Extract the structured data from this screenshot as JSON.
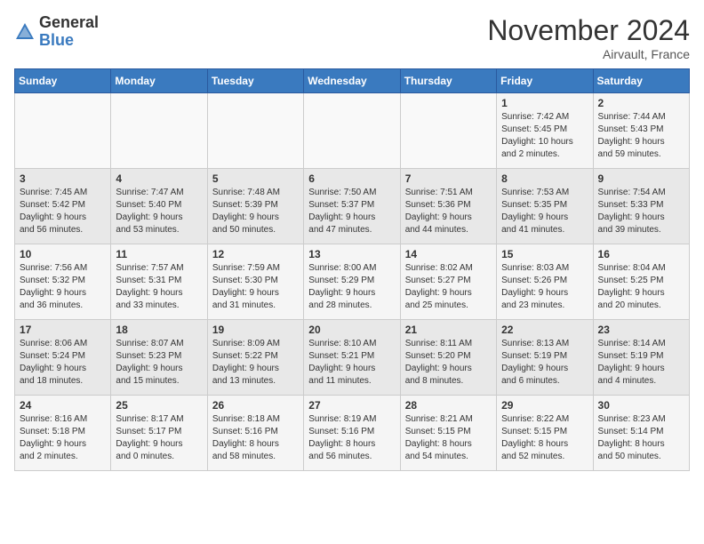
{
  "logo": {
    "general": "General",
    "blue": "Blue"
  },
  "header": {
    "month": "November 2024",
    "location": "Airvault, France"
  },
  "weekdays": [
    "Sunday",
    "Monday",
    "Tuesday",
    "Wednesday",
    "Thursday",
    "Friday",
    "Saturday"
  ],
  "weeks": [
    [
      {
        "day": "",
        "info": ""
      },
      {
        "day": "",
        "info": ""
      },
      {
        "day": "",
        "info": ""
      },
      {
        "day": "",
        "info": ""
      },
      {
        "day": "",
        "info": ""
      },
      {
        "day": "1",
        "info": "Sunrise: 7:42 AM\nSunset: 5:45 PM\nDaylight: 10 hours\nand 2 minutes."
      },
      {
        "day": "2",
        "info": "Sunrise: 7:44 AM\nSunset: 5:43 PM\nDaylight: 9 hours\nand 59 minutes."
      }
    ],
    [
      {
        "day": "3",
        "info": "Sunrise: 7:45 AM\nSunset: 5:42 PM\nDaylight: 9 hours\nand 56 minutes."
      },
      {
        "day": "4",
        "info": "Sunrise: 7:47 AM\nSunset: 5:40 PM\nDaylight: 9 hours\nand 53 minutes."
      },
      {
        "day": "5",
        "info": "Sunrise: 7:48 AM\nSunset: 5:39 PM\nDaylight: 9 hours\nand 50 minutes."
      },
      {
        "day": "6",
        "info": "Sunrise: 7:50 AM\nSunset: 5:37 PM\nDaylight: 9 hours\nand 47 minutes."
      },
      {
        "day": "7",
        "info": "Sunrise: 7:51 AM\nSunset: 5:36 PM\nDaylight: 9 hours\nand 44 minutes."
      },
      {
        "day": "8",
        "info": "Sunrise: 7:53 AM\nSunset: 5:35 PM\nDaylight: 9 hours\nand 41 minutes."
      },
      {
        "day": "9",
        "info": "Sunrise: 7:54 AM\nSunset: 5:33 PM\nDaylight: 9 hours\nand 39 minutes."
      }
    ],
    [
      {
        "day": "10",
        "info": "Sunrise: 7:56 AM\nSunset: 5:32 PM\nDaylight: 9 hours\nand 36 minutes."
      },
      {
        "day": "11",
        "info": "Sunrise: 7:57 AM\nSunset: 5:31 PM\nDaylight: 9 hours\nand 33 minutes."
      },
      {
        "day": "12",
        "info": "Sunrise: 7:59 AM\nSunset: 5:30 PM\nDaylight: 9 hours\nand 31 minutes."
      },
      {
        "day": "13",
        "info": "Sunrise: 8:00 AM\nSunset: 5:29 PM\nDaylight: 9 hours\nand 28 minutes."
      },
      {
        "day": "14",
        "info": "Sunrise: 8:02 AM\nSunset: 5:27 PM\nDaylight: 9 hours\nand 25 minutes."
      },
      {
        "day": "15",
        "info": "Sunrise: 8:03 AM\nSunset: 5:26 PM\nDaylight: 9 hours\nand 23 minutes."
      },
      {
        "day": "16",
        "info": "Sunrise: 8:04 AM\nSunset: 5:25 PM\nDaylight: 9 hours\nand 20 minutes."
      }
    ],
    [
      {
        "day": "17",
        "info": "Sunrise: 8:06 AM\nSunset: 5:24 PM\nDaylight: 9 hours\nand 18 minutes."
      },
      {
        "day": "18",
        "info": "Sunrise: 8:07 AM\nSunset: 5:23 PM\nDaylight: 9 hours\nand 15 minutes."
      },
      {
        "day": "19",
        "info": "Sunrise: 8:09 AM\nSunset: 5:22 PM\nDaylight: 9 hours\nand 13 minutes."
      },
      {
        "day": "20",
        "info": "Sunrise: 8:10 AM\nSunset: 5:21 PM\nDaylight: 9 hours\nand 11 minutes."
      },
      {
        "day": "21",
        "info": "Sunrise: 8:11 AM\nSunset: 5:20 PM\nDaylight: 9 hours\nand 8 minutes."
      },
      {
        "day": "22",
        "info": "Sunrise: 8:13 AM\nSunset: 5:19 PM\nDaylight: 9 hours\nand 6 minutes."
      },
      {
        "day": "23",
        "info": "Sunrise: 8:14 AM\nSunset: 5:19 PM\nDaylight: 9 hours\nand 4 minutes."
      }
    ],
    [
      {
        "day": "24",
        "info": "Sunrise: 8:16 AM\nSunset: 5:18 PM\nDaylight: 9 hours\nand 2 minutes."
      },
      {
        "day": "25",
        "info": "Sunrise: 8:17 AM\nSunset: 5:17 PM\nDaylight: 9 hours\nand 0 minutes."
      },
      {
        "day": "26",
        "info": "Sunrise: 8:18 AM\nSunset: 5:16 PM\nDaylight: 8 hours\nand 58 minutes."
      },
      {
        "day": "27",
        "info": "Sunrise: 8:19 AM\nSunset: 5:16 PM\nDaylight: 8 hours\nand 56 minutes."
      },
      {
        "day": "28",
        "info": "Sunrise: 8:21 AM\nSunset: 5:15 PM\nDaylight: 8 hours\nand 54 minutes."
      },
      {
        "day": "29",
        "info": "Sunrise: 8:22 AM\nSunset: 5:15 PM\nDaylight: 8 hours\nand 52 minutes."
      },
      {
        "day": "30",
        "info": "Sunrise: 8:23 AM\nSunset: 5:14 PM\nDaylight: 8 hours\nand 50 minutes."
      }
    ]
  ]
}
